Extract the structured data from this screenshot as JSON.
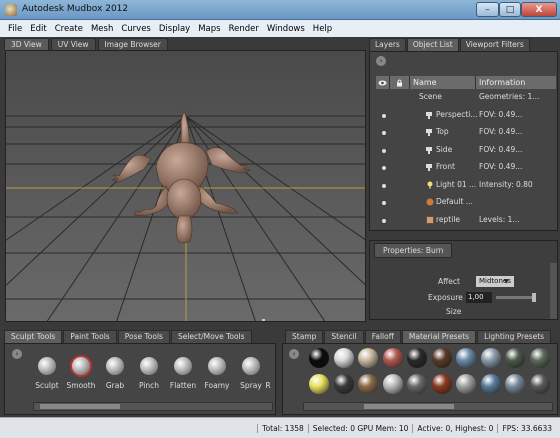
{
  "window": {
    "title": "Autodesk Mudbox 2012",
    "close": "X",
    "minimize": "–",
    "maximize": "□"
  },
  "menu": [
    "File",
    "Edit",
    "Create",
    "Mesh",
    "Curves",
    "Display",
    "Maps",
    "Render",
    "Windows",
    "Help"
  ],
  "viewport_tabs": [
    "3D View",
    "UV View",
    "Image Browser"
  ],
  "right_tabs": [
    "Layers",
    "Object List",
    "Viewport Filters"
  ],
  "object_list": {
    "headers": {
      "name": "Name",
      "info": "Information"
    },
    "rows": [
      {
        "name": "Scene",
        "info": "Geometries: 1..."
      },
      {
        "name": "Perspecti...",
        "info": "FOV: 0.49..."
      },
      {
        "name": "Top",
        "info": "FOV: 0.49..."
      },
      {
        "name": "Side",
        "info": "FOV: 0.49..."
      },
      {
        "name": "Front",
        "info": "FOV: 0.49..."
      },
      {
        "name": "Light 01 ...",
        "info": "Intensity: 0.80"
      },
      {
        "name": "Default ...",
        "info": ""
      },
      {
        "name": "reptile",
        "info": "Levels: 1..."
      }
    ]
  },
  "properties": {
    "tab": "Properties: Burn",
    "affect_label": "Affect",
    "affect_value": "Midtones",
    "exposure_label": "Exposure",
    "exposure_value": "1,00",
    "size_label": "Size"
  },
  "tool_tabs": [
    "Sculpt Tools",
    "Paint Tools",
    "Pose Tools",
    "Select/Move Tools"
  ],
  "tools": [
    "Sculpt",
    "Smooth",
    "Grab",
    "Pinch",
    "Flatten",
    "Foamy",
    "Spray",
    "R"
  ],
  "material_tabs": [
    "Stamp",
    "Stencil",
    "Falloff",
    "Material Presets",
    "Lighting Presets"
  ],
  "swatch_colors": [
    [
      "#0a0a0a",
      "#d8d8d8",
      "#c8b8a0",
      "#b05a50",
      "#2a2a2a",
      "#5a3a2a",
      "#6a8aaa",
      "#8a9aaa",
      "#4a5a4a",
      "#5a6a5a"
    ],
    [
      "#e8e060",
      "#3a3a3a",
      "#8a6a4a",
      "#bcbcbc",
      "#6a6a6a",
      "#8a3a20",
      "#a0a0a0",
      "#5a7a9a",
      "#7a8a9a",
      "#5a5a5a"
    ]
  ],
  "status": {
    "total": "Total: 1358",
    "selected": "Selected: 0 GPU Mem: 10",
    "active": "Active: 0, Highest: 0",
    "fps": "FPS: 33.6633"
  }
}
